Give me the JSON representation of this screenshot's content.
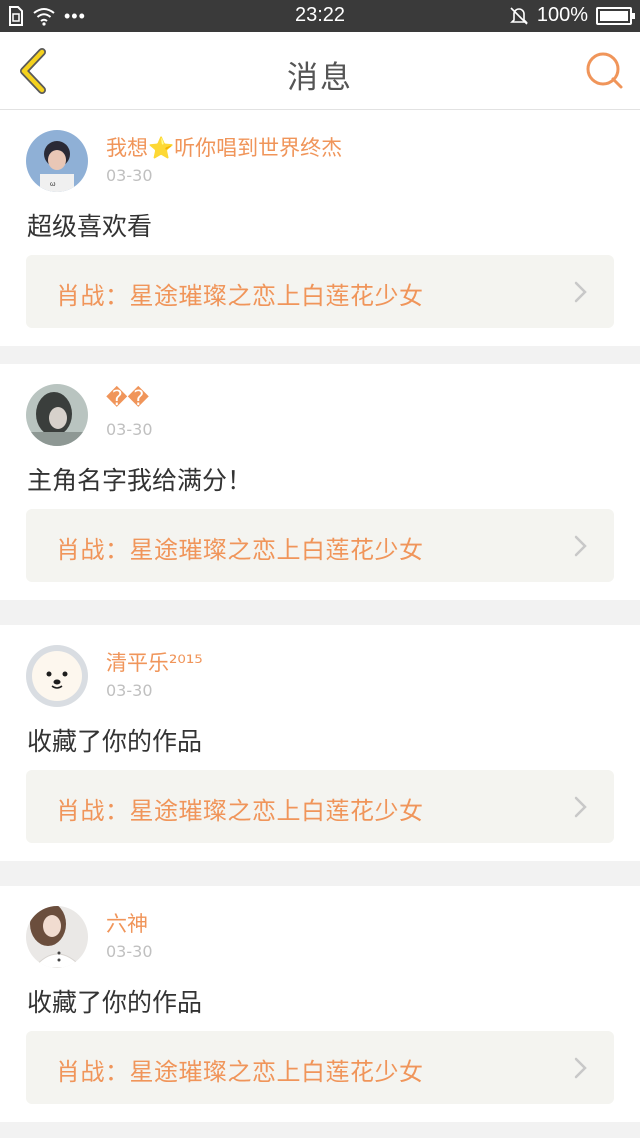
{
  "status_bar": {
    "time": "23:22",
    "battery": "100%",
    "icons": [
      "sim-icon",
      "wifi-icon",
      "more-icon",
      "mute-icon",
      "battery-icon"
    ]
  },
  "header": {
    "title": "消息",
    "back_icon": "back-chevron-icon",
    "search_icon": "search-icon",
    "accent_color": "#f0955a"
  },
  "messages": [
    {
      "username": "我想⭐听你唱到世界终杰",
      "time": "03-30",
      "text": "超级喜欢看",
      "work": "肖战：星途璀璨之恋上白莲花少女"
    },
    {
      "username": "��",
      "time": "03-30",
      "text": "主角名字我给满分！",
      "work": "肖战：星途璀璨之恋上白莲花少女"
    },
    {
      "username": "清平乐²⁰¹⁵",
      "time": "03-30",
      "text": "收藏了你的作品",
      "work": "肖战：星途璀璨之恋上白莲花少女"
    },
    {
      "username": "六神",
      "time": "03-30",
      "text": "收藏了你的作品",
      "work": "肖战：星途璀璨之恋上白莲花少女"
    }
  ]
}
